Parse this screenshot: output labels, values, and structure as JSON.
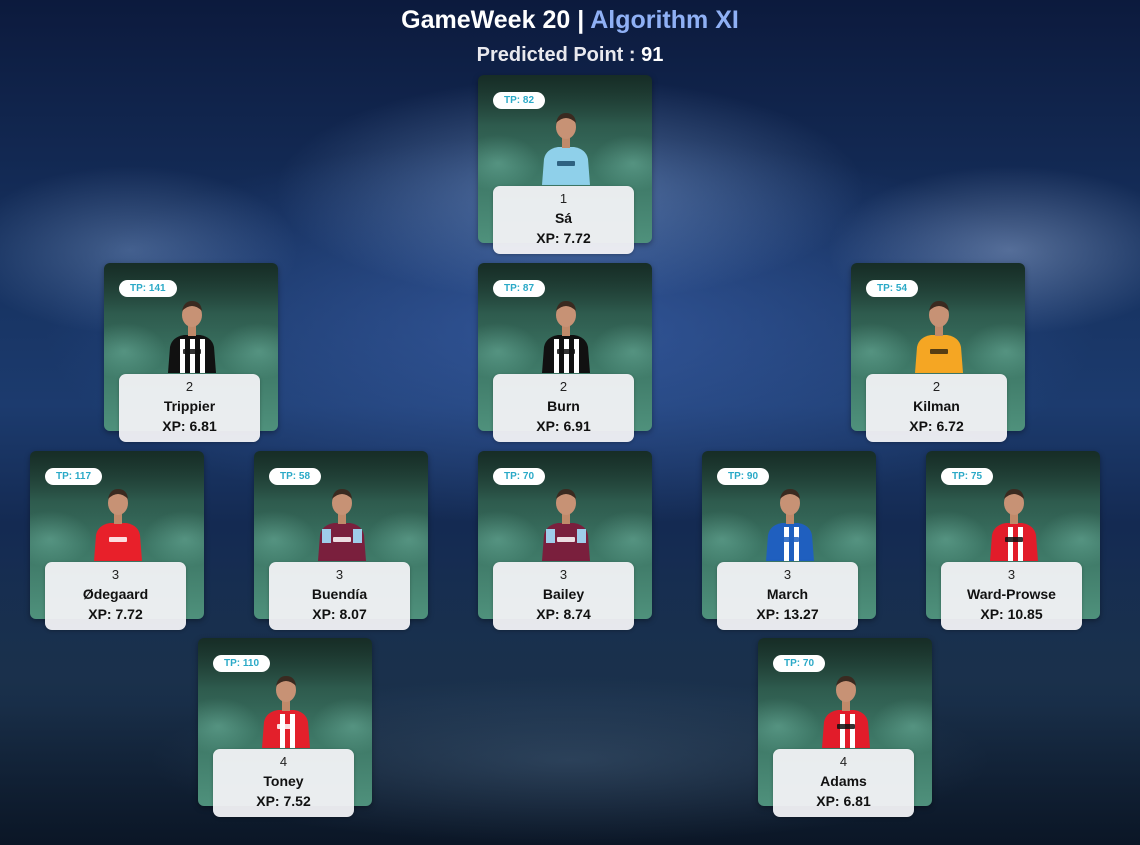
{
  "header": {
    "title_main": "GameWeek 20 | ",
    "title_accent": "Algorithm XI",
    "predicted_label": "Predicted Point : ",
    "predicted_value": "91"
  },
  "players": [
    {
      "tp": "TP: 82",
      "pos": "1",
      "name": "Sá",
      "xp": "XP: 7.72",
      "kit": "wolves-gk"
    },
    {
      "tp": "TP: 141",
      "pos": "2",
      "name": "Trippier",
      "xp": "XP: 6.81",
      "kit": "newcastle"
    },
    {
      "tp": "TP: 87",
      "pos": "2",
      "name": "Burn",
      "xp": "XP: 6.91",
      "kit": "newcastle"
    },
    {
      "tp": "TP: 54",
      "pos": "2",
      "name": "Kilman",
      "xp": "XP: 6.72",
      "kit": "wolves"
    },
    {
      "tp": "TP: 117",
      "pos": "3",
      "name": "Ødegaard",
      "xp": "XP: 7.72",
      "kit": "arsenal"
    },
    {
      "tp": "TP: 58",
      "pos": "3",
      "name": "Buendía",
      "xp": "XP: 8.07",
      "kit": "villa"
    },
    {
      "tp": "TP: 70",
      "pos": "3",
      "name": "Bailey",
      "xp": "XP: 8.74",
      "kit": "villa"
    },
    {
      "tp": "TP: 90",
      "pos": "3",
      "name": "March",
      "xp": "XP: 13.27",
      "kit": "brighton"
    },
    {
      "tp": "TP: 75",
      "pos": "3",
      "name": "Ward-Prowse",
      "xp": "XP: 10.85",
      "kit": "southampton"
    },
    {
      "tp": "TP: 110",
      "pos": "4",
      "name": "Toney",
      "xp": "XP: 7.52",
      "kit": "brentford"
    },
    {
      "tp": "TP: 70",
      "pos": "4",
      "name": "Adams",
      "xp": "XP: 6.81",
      "kit": "southampton"
    }
  ],
  "kit_colors": {
    "wolves-gk": [
      "#8fd0ea",
      "#e8f6fb",
      "#1e4f6e"
    ],
    "newcastle": [
      "#111111",
      "#ffffff",
      "#111111"
    ],
    "wolves": [
      "#f5a623",
      "#f5a623",
      "#3a2a10"
    ],
    "arsenal": [
      "#e8202a",
      "#ffffff",
      "#ffffff"
    ],
    "villa": [
      "#7a1f3d",
      "#9fcdea",
      "#ffffff"
    ],
    "brighton": [
      "#1f5fbf",
      "#ffffff",
      "#1f5fbf"
    ],
    "southampton": [
      "#e21c2a",
      "#ffffff",
      "#111111"
    ],
    "brentford": [
      "#e3202b",
      "#ffffff",
      "#ffffff"
    ]
  },
  "icons": {
    "player_photo": "player-photo-icon"
  }
}
